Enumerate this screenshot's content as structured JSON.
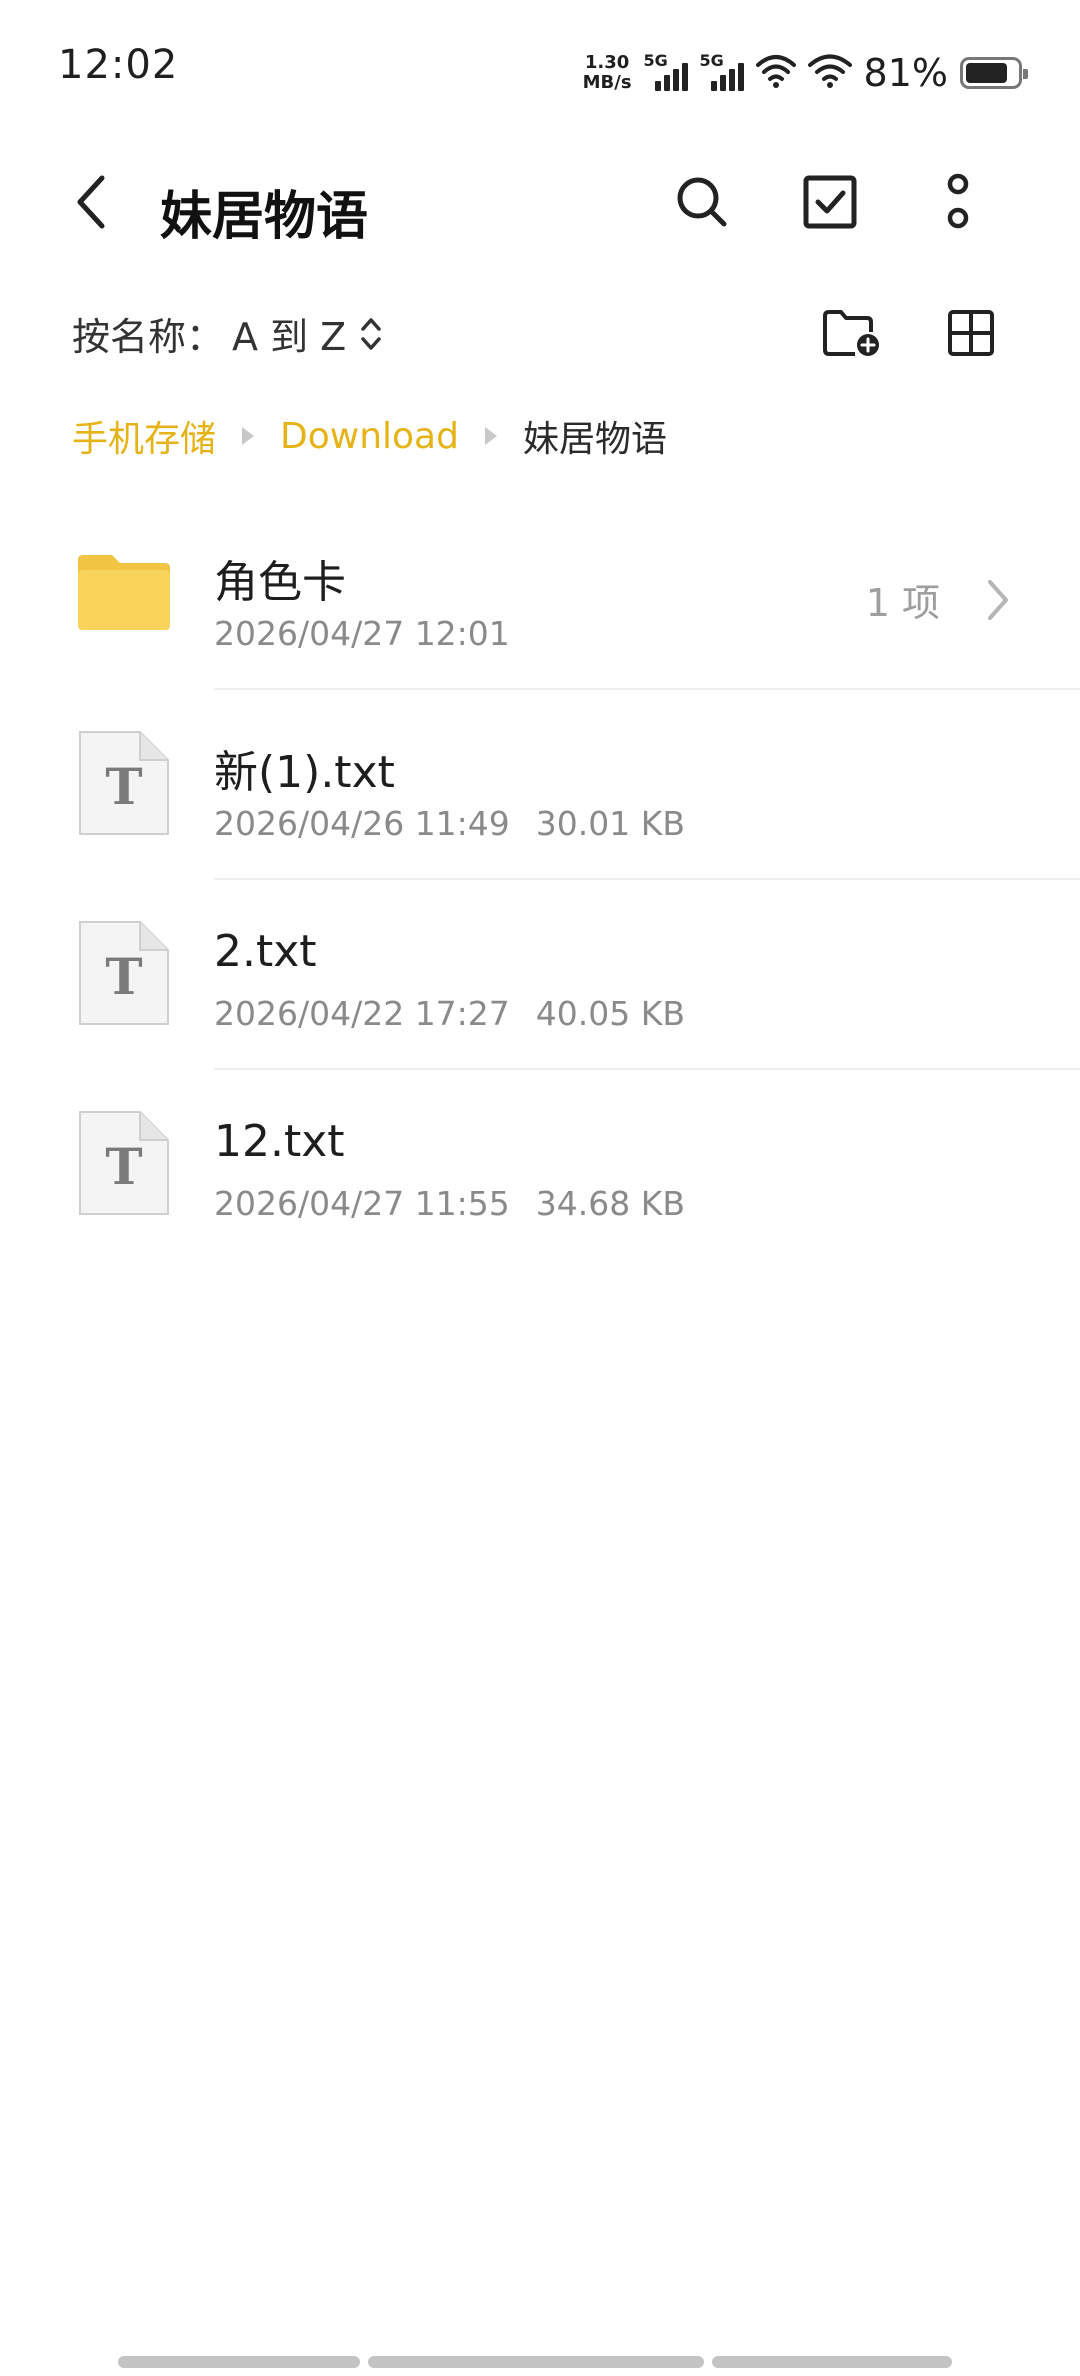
{
  "status_bar": {
    "time": "12:02",
    "net_speed_value": "1.30",
    "net_speed_unit": "MB/s",
    "sim1_label": "5G",
    "sim2_label": "5G",
    "battery_percent": "81%",
    "battery_level": 0.81
  },
  "toolbar": {
    "title": "妹居物语",
    "back_icon": "back-arrow-icon",
    "search_icon": "search-icon",
    "select_icon": "checkbox-icon",
    "more_icon": "more-vertical-icon"
  },
  "sort": {
    "label": "按名称：",
    "value": "A 到 Z",
    "new_folder_icon": "new-folder-icon",
    "grid_view_icon": "grid-view-icon"
  },
  "breadcrumb": {
    "items": [
      "手机存储",
      "Download",
      "妹居物语"
    ]
  },
  "files": [
    {
      "type": "folder",
      "name": "角色卡",
      "date": "2026/04/27 12:01",
      "size": "",
      "count": "1 项"
    },
    {
      "type": "txt",
      "name": "新(1).txt",
      "date": "2026/04/26 11:49",
      "size": "30.01 KB",
      "count": ""
    },
    {
      "type": "txt",
      "name": "2.txt",
      "date": "2026/04/22 17:27",
      "size": "40.05 KB",
      "count": ""
    },
    {
      "type": "txt",
      "name": "12.txt",
      "date": "2026/04/27 11:55",
      "size": "34.68 KB",
      "count": ""
    }
  ],
  "colors": {
    "accent": "#e6b316",
    "folder": "#f8d55a",
    "folder_tab": "#f2c443"
  }
}
